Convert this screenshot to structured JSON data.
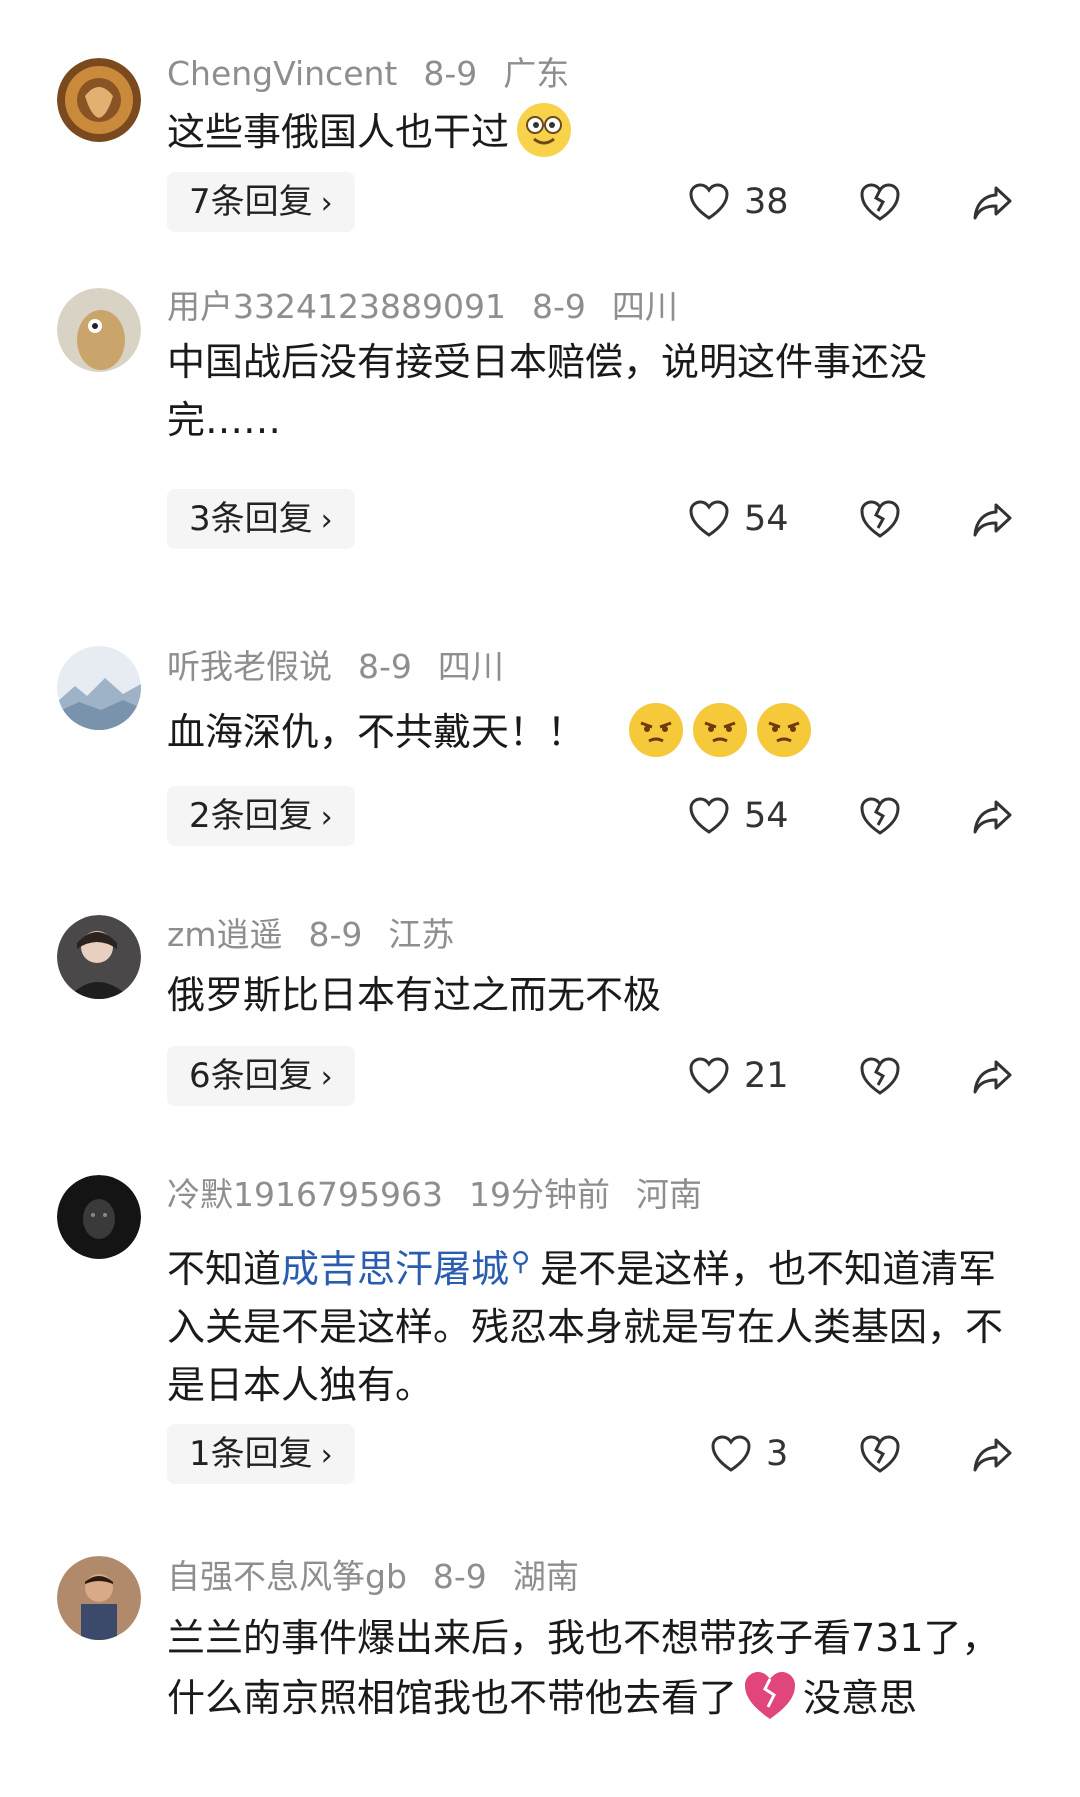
{
  "comments": [
    {
      "username": "ChengVincent",
      "date": "8-9",
      "location": "广东",
      "text": "这些事俄国人也干过",
      "replies_label": "7条回复",
      "likes": "38"
    },
    {
      "username": "用户3324123889091",
      "date": "8-9",
      "location": "四川",
      "text": "中国战后没有接受日本赔偿，说明这件事还没完……",
      "replies_label": "3条回复",
      "likes": "54"
    },
    {
      "username": "听我老假说",
      "date": "8-9",
      "location": "四川",
      "text": "血海深仇，不共戴天！！",
      "replies_label": "2条回复",
      "likes": "54"
    },
    {
      "username": "zm逍遥",
      "date": "8-9",
      "location": "江苏",
      "text": "俄罗斯比日本有过之而无不极",
      "replies_label": "6条回复",
      "likes": "21"
    },
    {
      "username": "冷默1916795963",
      "date": "19分钟前",
      "location": "河南",
      "text_before": "不知道",
      "text_link": "成吉思汗屠城",
      "text_after": "是不是这样，也不知道清军入关是不是这样。残忍本身就是写在人类基因，不是日本人独有。",
      "replies_label": "1条回复",
      "likes": "3"
    },
    {
      "username": "自强不息风筝gb",
      "date": "8-9",
      "location": "湖南",
      "text_before": "兰兰的事件爆出来后，我也不想带孩子看731了，什么南京照相馆我也不带他去看了",
      "text_after": "没意思"
    }
  ],
  "icons": {
    "like": "heart-outline-icon",
    "dislike": "broken-heart-outline-icon",
    "share": "share-arrow-icon",
    "search": "search-icon",
    "chevron": "chevron-right-icon"
  },
  "colors": {
    "meta": "#8e8e8e",
    "link": "#2a5db0",
    "reply_bg": "#f5f5f5",
    "broken_heart": "#e0457b"
  }
}
